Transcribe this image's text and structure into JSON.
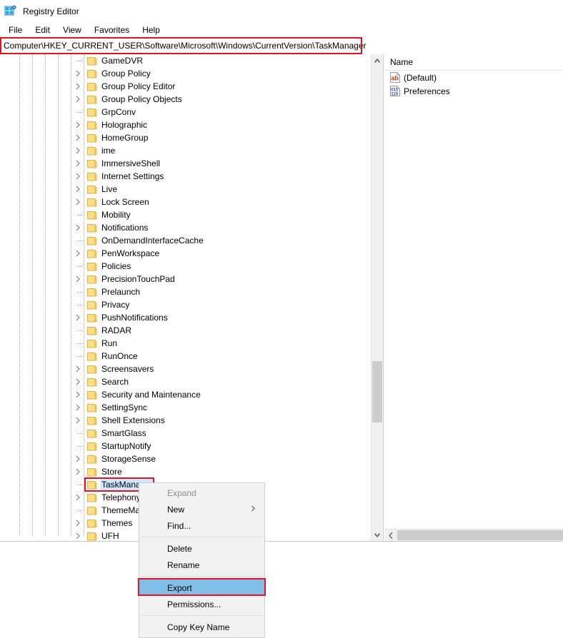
{
  "window": {
    "title": "Registry Editor",
    "icon": "registry-editor-icon"
  },
  "menubar": {
    "items": [
      "File",
      "Edit",
      "View",
      "Favorites",
      "Help"
    ]
  },
  "address_bar": {
    "path": "Computer\\HKEY_CURRENT_USER\\Software\\Microsoft\\Windows\\CurrentVersion\\TaskManager",
    "highlight_color": "#e81123"
  },
  "tree": {
    "items": [
      {
        "label": "GameDVR",
        "expandable": false,
        "selected": false
      },
      {
        "label": "Group Policy",
        "expandable": true,
        "selected": false
      },
      {
        "label": "Group Policy Editor",
        "expandable": true,
        "selected": false
      },
      {
        "label": "Group Policy Objects",
        "expandable": true,
        "selected": false
      },
      {
        "label": "GrpConv",
        "expandable": false,
        "selected": false
      },
      {
        "label": "Holographic",
        "expandable": true,
        "selected": false
      },
      {
        "label": "HomeGroup",
        "expandable": true,
        "selected": false
      },
      {
        "label": "ime",
        "expandable": true,
        "selected": false
      },
      {
        "label": "ImmersiveShell",
        "expandable": true,
        "selected": false
      },
      {
        "label": "Internet Settings",
        "expandable": true,
        "selected": false
      },
      {
        "label": "Live",
        "expandable": true,
        "selected": false
      },
      {
        "label": "Lock Screen",
        "expandable": true,
        "selected": false
      },
      {
        "label": "Mobility",
        "expandable": false,
        "selected": false
      },
      {
        "label": "Notifications",
        "expandable": true,
        "selected": false
      },
      {
        "label": "OnDemandInterfaceCache",
        "expandable": false,
        "selected": false
      },
      {
        "label": "PenWorkspace",
        "expandable": true,
        "selected": false
      },
      {
        "label": "Policies",
        "expandable": false,
        "selected": false
      },
      {
        "label": "PrecisionTouchPad",
        "expandable": true,
        "selected": false
      },
      {
        "label": "Prelaunch",
        "expandable": false,
        "selected": false
      },
      {
        "label": "Privacy",
        "expandable": false,
        "selected": false
      },
      {
        "label": "PushNotifications",
        "expandable": true,
        "selected": false
      },
      {
        "label": "RADAR",
        "expandable": false,
        "selected": false
      },
      {
        "label": "Run",
        "expandable": false,
        "selected": false
      },
      {
        "label": "RunOnce",
        "expandable": false,
        "selected": false
      },
      {
        "label": "Screensavers",
        "expandable": true,
        "selected": false
      },
      {
        "label": "Search",
        "expandable": true,
        "selected": false
      },
      {
        "label": "Security and Maintenance",
        "expandable": true,
        "selected": false
      },
      {
        "label": "SettingSync",
        "expandable": true,
        "selected": false
      },
      {
        "label": "Shell Extensions",
        "expandable": true,
        "selected": false
      },
      {
        "label": "SmartGlass",
        "expandable": false,
        "selected": false
      },
      {
        "label": "StartupNotify",
        "expandable": false,
        "selected": false
      },
      {
        "label": "StorageSense",
        "expandable": true,
        "selected": false
      },
      {
        "label": "Store",
        "expandable": true,
        "selected": false
      },
      {
        "label": "TaskManager",
        "expandable": false,
        "selected": true
      },
      {
        "label": "Telephony",
        "expandable": true,
        "selected": false
      },
      {
        "label": "ThemeManager",
        "expandable": false,
        "selected": false
      },
      {
        "label": "Themes",
        "expandable": true,
        "selected": false
      },
      {
        "label": "UFH",
        "expandable": true,
        "selected": false
      }
    ],
    "selected_highlight_color": "#e81123",
    "selection_fill": "#cde8ff"
  },
  "values_pane": {
    "column_header": "Name",
    "rows": [
      {
        "name": "(Default)",
        "icon": "string-value-icon"
      },
      {
        "name": "Preferences",
        "icon": "binary-value-icon"
      }
    ]
  },
  "context_menu": {
    "items": [
      {
        "label": "Expand",
        "disabled": true,
        "submenu": false,
        "highlighted": false
      },
      {
        "label": "New",
        "disabled": false,
        "submenu": true,
        "highlighted": false
      },
      {
        "label": "Find...",
        "disabled": false,
        "submenu": false,
        "highlighted": false
      },
      {
        "separator": true
      },
      {
        "label": "Delete",
        "disabled": false,
        "submenu": false,
        "highlighted": false
      },
      {
        "label": "Rename",
        "disabled": false,
        "submenu": false,
        "highlighted": false
      },
      {
        "separator": true
      },
      {
        "label": "Export",
        "disabled": false,
        "submenu": false,
        "highlighted": true
      },
      {
        "label": "Permissions...",
        "disabled": false,
        "submenu": false,
        "highlighted": false
      },
      {
        "separator": true
      },
      {
        "label": "Copy Key Name",
        "disabled": false,
        "submenu": false,
        "highlighted": false
      }
    ],
    "highlight_fill": "#82bfe8",
    "annotation_color": "#e81123",
    "submenu_glyph": "›"
  },
  "scrollbars": {
    "tree_up_arrow": "▲",
    "tree_down_arrow": "▼",
    "values_left_arrow": "‹"
  }
}
